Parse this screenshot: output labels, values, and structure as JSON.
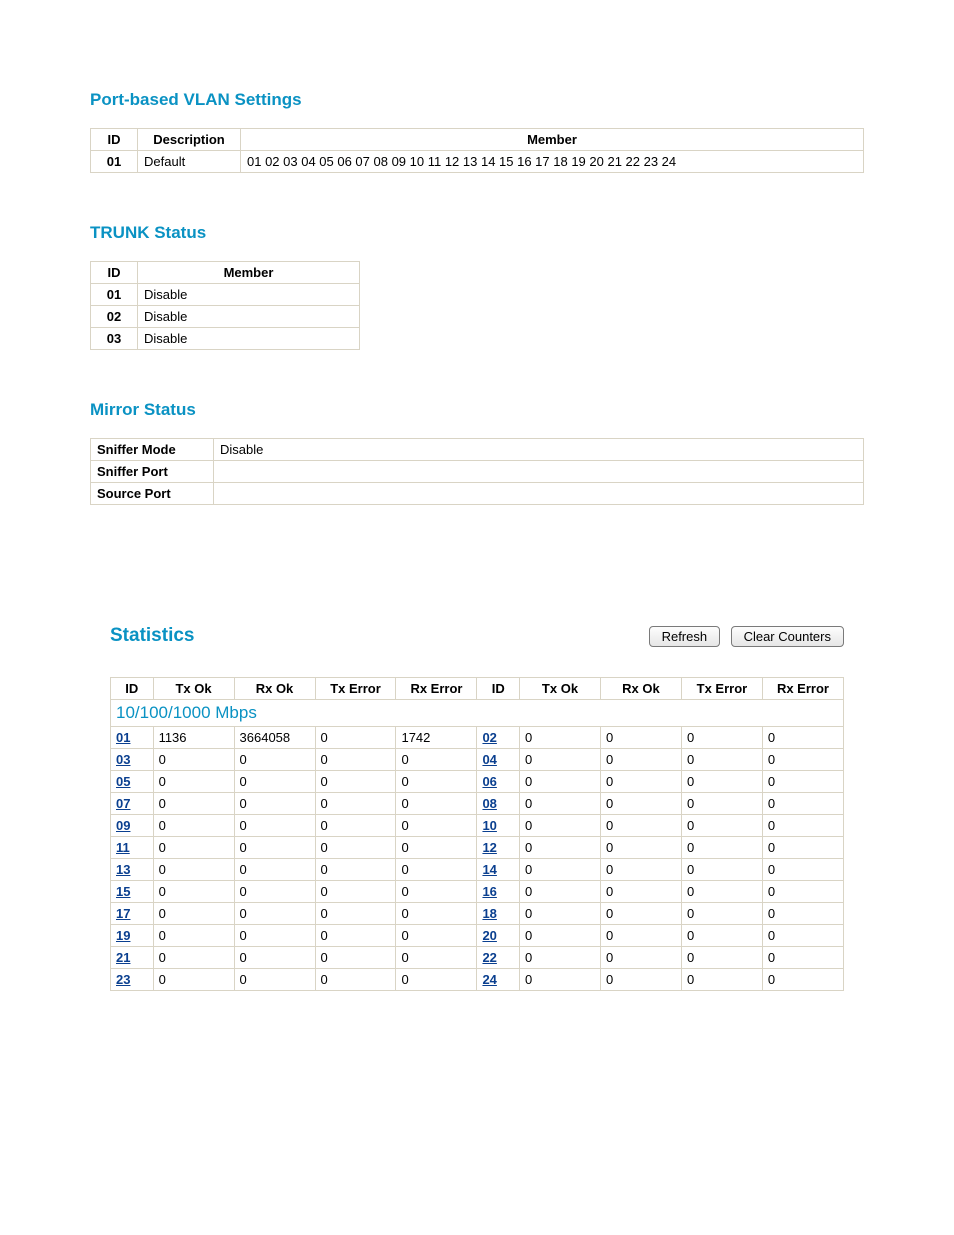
{
  "vlan": {
    "title": "Port-based VLAN Settings",
    "headers": {
      "id": "ID",
      "description": "Description",
      "member": "Member"
    },
    "rows": [
      {
        "id": "01",
        "description": "Default",
        "member": "01 02 03 04 05 06 07 08 09 10 11 12 13 14 15 16 17 18 19 20 21 22 23 24"
      }
    ]
  },
  "trunk": {
    "title": "TRUNK Status",
    "headers": {
      "id": "ID",
      "member": "Member"
    },
    "rows": [
      {
        "id": "01",
        "member": "Disable"
      },
      {
        "id": "02",
        "member": "Disable"
      },
      {
        "id": "03",
        "member": "Disable"
      }
    ]
  },
  "mirror": {
    "title": "Mirror Status",
    "rows": [
      {
        "label": "Sniffer Mode",
        "value": "Disable"
      },
      {
        "label": "Sniffer Port",
        "value": ""
      },
      {
        "label": "Source Port",
        "value": ""
      }
    ]
  },
  "stats": {
    "title": "Statistics",
    "buttons": {
      "refresh": "Refresh",
      "clear": "Clear Counters"
    },
    "headers": {
      "id": "ID",
      "txok": "Tx Ok",
      "rxok": "Rx Ok",
      "txerr": "Tx Error",
      "rxerr": "Rx Error"
    },
    "speed_label": "10/100/1000 Mbps",
    "rows": [
      {
        "left": {
          "id": "01",
          "txok": "1136",
          "rxok": "3664058",
          "txerr": "0",
          "rxerr": "1742"
        },
        "right": {
          "id": "02",
          "txok": "0",
          "rxok": "0",
          "txerr": "0",
          "rxerr": "0"
        }
      },
      {
        "left": {
          "id": "03",
          "txok": "0",
          "rxok": "0",
          "txerr": "0",
          "rxerr": "0"
        },
        "right": {
          "id": "04",
          "txok": "0",
          "rxok": "0",
          "txerr": "0",
          "rxerr": "0"
        }
      },
      {
        "left": {
          "id": "05",
          "txok": "0",
          "rxok": "0",
          "txerr": "0",
          "rxerr": "0"
        },
        "right": {
          "id": "06",
          "txok": "0",
          "rxok": "0",
          "txerr": "0",
          "rxerr": "0"
        }
      },
      {
        "left": {
          "id": "07",
          "txok": "0",
          "rxok": "0",
          "txerr": "0",
          "rxerr": "0"
        },
        "right": {
          "id": "08",
          "txok": "0",
          "rxok": "0",
          "txerr": "0",
          "rxerr": "0"
        }
      },
      {
        "left": {
          "id": "09",
          "txok": "0",
          "rxok": "0",
          "txerr": "0",
          "rxerr": "0"
        },
        "right": {
          "id": "10",
          "txok": "0",
          "rxok": "0",
          "txerr": "0",
          "rxerr": "0"
        }
      },
      {
        "left": {
          "id": "11",
          "txok": "0",
          "rxok": "0",
          "txerr": "0",
          "rxerr": "0"
        },
        "right": {
          "id": "12",
          "txok": "0",
          "rxok": "0",
          "txerr": "0",
          "rxerr": "0"
        }
      },
      {
        "left": {
          "id": "13",
          "txok": "0",
          "rxok": "0",
          "txerr": "0",
          "rxerr": "0"
        },
        "right": {
          "id": "14",
          "txok": "0",
          "rxok": "0",
          "txerr": "0",
          "rxerr": "0"
        }
      },
      {
        "left": {
          "id": "15",
          "txok": "0",
          "rxok": "0",
          "txerr": "0",
          "rxerr": "0"
        },
        "right": {
          "id": "16",
          "txok": "0",
          "rxok": "0",
          "txerr": "0",
          "rxerr": "0"
        }
      },
      {
        "left": {
          "id": "17",
          "txok": "0",
          "rxok": "0",
          "txerr": "0",
          "rxerr": "0"
        },
        "right": {
          "id": "18",
          "txok": "0",
          "rxok": "0",
          "txerr": "0",
          "rxerr": "0"
        }
      },
      {
        "left": {
          "id": "19",
          "txok": "0",
          "rxok": "0",
          "txerr": "0",
          "rxerr": "0"
        },
        "right": {
          "id": "20",
          "txok": "0",
          "rxok": "0",
          "txerr": "0",
          "rxerr": "0"
        }
      },
      {
        "left": {
          "id": "21",
          "txok": "0",
          "rxok": "0",
          "txerr": "0",
          "rxerr": "0"
        },
        "right": {
          "id": "22",
          "txok": "0",
          "rxok": "0",
          "txerr": "0",
          "rxerr": "0"
        }
      },
      {
        "left": {
          "id": "23",
          "txok": "0",
          "rxok": "0",
          "txerr": "0",
          "rxerr": "0"
        },
        "right": {
          "id": "24",
          "txok": "0",
          "rxok": "0",
          "txerr": "0",
          "rxerr": "0"
        }
      }
    ]
  }
}
